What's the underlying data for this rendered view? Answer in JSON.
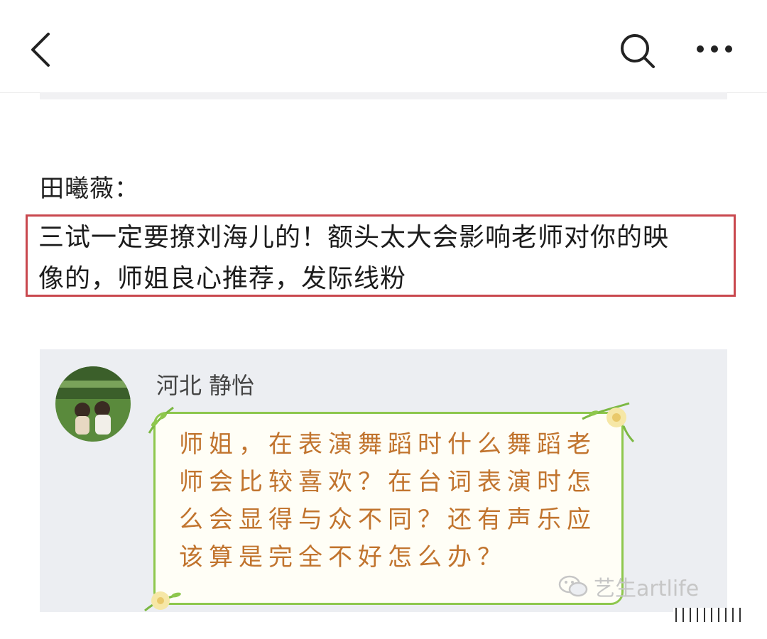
{
  "nav": {
    "back_icon": "chevron-left-icon",
    "search_icon": "search-icon",
    "more_icon": "more-dots-icon"
  },
  "post": {
    "speaker": "田曦薇：",
    "quote_line1": "三试一定要撩刘海儿的！额头太大会影响老师对你的映",
    "quote_line2": "像的，师姐良心推荐，发际线粉"
  },
  "embedded": {
    "poster": "河北  静怡",
    "question_lines": [
      "师姐，在表演舞蹈时什么舞蹈老",
      "师会比较喜欢？在台词表演时怎",
      "么会显得与众不同？还有声乐应",
      "该算是完全不好怎么办？"
    ],
    "watermark": "艺生artlife"
  },
  "colors": {
    "highlight_border": "#c9484e",
    "card_border": "#8ec74d",
    "card_text": "#c1742e"
  }
}
